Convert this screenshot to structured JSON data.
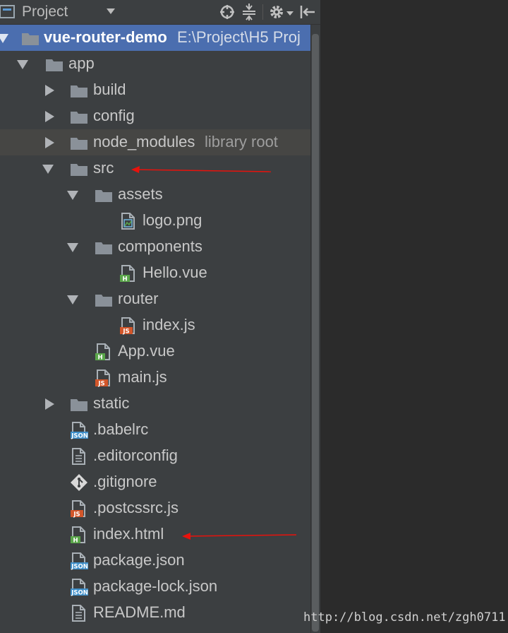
{
  "header": {
    "title": "Project"
  },
  "tree": [
    {
      "label": "vue-router-demo",
      "suffix": "E:\\Project\\H5 Proj",
      "icon": "folder-icon",
      "depth": 0,
      "state": "expanded",
      "selected": true,
      "bold": true
    },
    {
      "label": "app",
      "icon": "folder-icon",
      "depth": 1,
      "state": "expanded"
    },
    {
      "label": "build",
      "icon": "folder-icon",
      "depth": 2,
      "state": "collapsed"
    },
    {
      "label": "config",
      "icon": "folder-icon",
      "depth": 2,
      "state": "collapsed"
    },
    {
      "label": "node_modules",
      "suffix": "library root",
      "icon": "folder-icon",
      "depth": 2,
      "state": "collapsed",
      "highlight": true
    },
    {
      "label": "src",
      "icon": "folder-icon",
      "depth": 2,
      "state": "expanded"
    },
    {
      "label": "assets",
      "icon": "folder-icon",
      "depth": 3,
      "state": "expanded"
    },
    {
      "label": "logo.png",
      "icon": "image-file-icon",
      "depth": 4,
      "state": "leaf"
    },
    {
      "label": "components",
      "icon": "folder-icon",
      "depth": 3,
      "state": "expanded"
    },
    {
      "label": "Hello.vue",
      "icon": "html-file-icon",
      "depth": 4,
      "state": "leaf"
    },
    {
      "label": "router",
      "icon": "folder-icon",
      "depth": 3,
      "state": "expanded"
    },
    {
      "label": "index.js",
      "icon": "js-file-icon",
      "depth": 4,
      "state": "leaf"
    },
    {
      "label": "App.vue",
      "icon": "html-file-icon",
      "depth": 3,
      "state": "leaf"
    },
    {
      "label": "main.js",
      "icon": "js-file-icon",
      "depth": 3,
      "state": "leaf"
    },
    {
      "label": "static",
      "icon": "folder-icon",
      "depth": 2,
      "state": "collapsed"
    },
    {
      "label": ".babelrc",
      "icon": "json-file-icon",
      "depth": 2,
      "state": "leaf"
    },
    {
      "label": ".editorconfig",
      "icon": "text-file-icon",
      "depth": 2,
      "state": "leaf"
    },
    {
      "label": ".gitignore",
      "icon": "git-file-icon",
      "depth": 2,
      "state": "leaf"
    },
    {
      "label": ".postcssrc.js",
      "icon": "js-file-icon",
      "depth": 2,
      "state": "leaf"
    },
    {
      "label": "index.html",
      "icon": "html-file-icon",
      "depth": 2,
      "state": "leaf"
    },
    {
      "label": "package.json",
      "icon": "json-file-icon",
      "depth": 2,
      "state": "leaf"
    },
    {
      "label": "package-lock.json",
      "icon": "json-file-icon",
      "depth": 2,
      "state": "leaf"
    },
    {
      "label": "README.md",
      "icon": "text-file-icon",
      "depth": 2,
      "state": "leaf"
    }
  ],
  "annotations": {
    "color": "#e8120c",
    "pointing_at": [
      "src",
      "index.html"
    ]
  },
  "watermark": "http://blog.csdn.net/zgh0711",
  "colors": {
    "panel": "#3c3f41",
    "selection": "#4b6eaf",
    "folder": "#8a9199",
    "html_badge": "#5aa64a",
    "js_badge": "#d2562a",
    "json_badge": "#3f8fc9"
  }
}
